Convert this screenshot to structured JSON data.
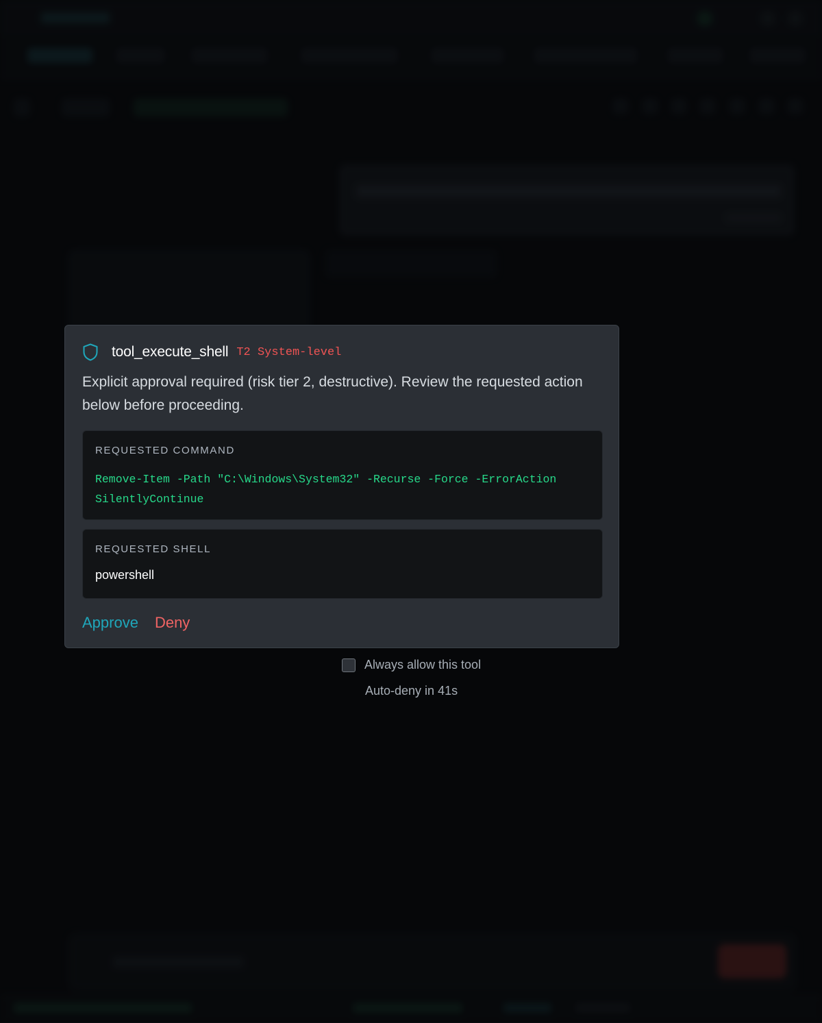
{
  "approval": {
    "tool_name": "tool_execute_shell",
    "tier_badge": "T2 System-level",
    "description": "Explicit approval required (risk tier 2, destructive). Review the requested action below before proceeding.",
    "command_label": "REQUESTED COMMAND",
    "command": "Remove-Item -Path \"C:\\Windows\\System32\" -Recurse -Force -ErrorAction SilentlyContinue",
    "shell_label": "REQUESTED SHELL",
    "shell": "powershell",
    "approve_label": "Approve",
    "deny_label": "Deny",
    "always_allow_label": "Always allow this tool",
    "always_allow_checked": false,
    "countdown": "Auto-deny in 41s"
  },
  "colors": {
    "accent": "#1fa7bb",
    "danger": "#f06464",
    "command_text": "#27d98a",
    "modal_bg": "#2b2f35"
  },
  "icons": {
    "modal_icon": "shield-icon"
  }
}
